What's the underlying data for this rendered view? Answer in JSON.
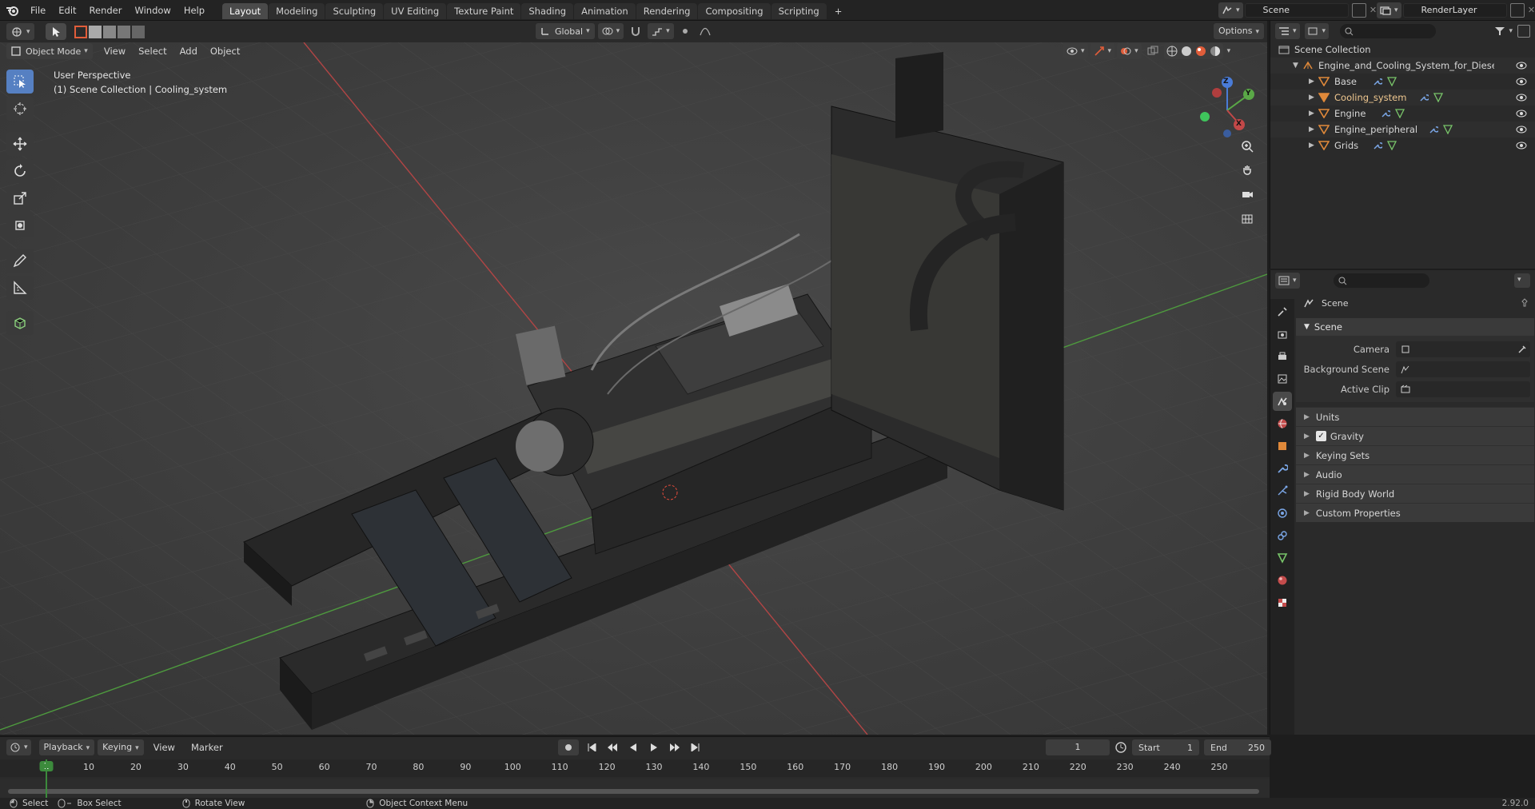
{
  "topbar": {
    "menus": [
      "File",
      "Edit",
      "Render",
      "Window",
      "Help"
    ],
    "workspaces": [
      "Layout",
      "Modeling",
      "Sculpting",
      "UV Editing",
      "Texture Paint",
      "Shading",
      "Animation",
      "Rendering",
      "Compositing",
      "Scripting"
    ],
    "active_workspace": "Layout",
    "add_tab": "+",
    "scene_name": "Scene",
    "view_layer_name": "RenderLayer"
  },
  "viewport_header": {
    "mode": "Object Mode",
    "menus": [
      "View",
      "Select",
      "Add",
      "Object"
    ],
    "orientation": "Global",
    "options_label": "Options"
  },
  "viewport": {
    "perspective_label": "User Perspective",
    "context_label": "(1) Scene Collection | Cooling_system",
    "gizmo_axes": {
      "x": "X",
      "y": "Y",
      "z": "Z"
    }
  },
  "outliner": {
    "root": "Scene Collection",
    "collection": "Engine_and_Cooling_System_for_Diesel_Gen",
    "items": [
      {
        "label": "Base"
      },
      {
        "label": "Cooling_system"
      },
      {
        "label": "Engine"
      },
      {
        "label": "Engine_peripheral"
      },
      {
        "label": "Grids"
      }
    ]
  },
  "properties": {
    "context_title": "Scene",
    "panel_title": "Scene",
    "fields": [
      {
        "label": "Camera",
        "value": ""
      },
      {
        "label": "Background Scene",
        "value": ""
      },
      {
        "label": "Active Clip",
        "value": ""
      }
    ],
    "subpanels": [
      "Units",
      "Gravity",
      "Keying Sets",
      "Audio",
      "Rigid Body World",
      "Custom Properties"
    ],
    "gravity_checked": true
  },
  "timeline": {
    "menus": [
      "Playback",
      "Keying",
      "View",
      "Marker"
    ],
    "current_frame": "1",
    "start_label": "Start",
    "start_value": "1",
    "end_label": "End",
    "end_value": "250",
    "ruler": [
      "1",
      "10",
      "20",
      "30",
      "40",
      "50",
      "60",
      "70",
      "80",
      "90",
      "100",
      "110",
      "120",
      "130",
      "140",
      "150",
      "160",
      "170",
      "180",
      "190",
      "200",
      "210",
      "220",
      "230",
      "240",
      "250"
    ]
  },
  "statusbar": {
    "items": [
      "Select",
      "Box Select",
      "Rotate View",
      "Object Context Menu"
    ],
    "version": "2.92.0"
  },
  "colors": {
    "accent": "#5680c2",
    "active_frame": "#3c8a3c",
    "axis_x": "#c24848",
    "axis_y": "#5aa847",
    "axis_z": "#4a7cd8",
    "object_icon": "#e0893a"
  }
}
